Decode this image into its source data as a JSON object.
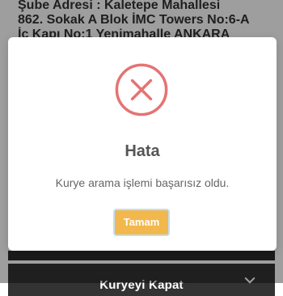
{
  "background": {
    "address_text": "Şube Adresi      : Kaletepe Mahallesi\n862. Sokak A Blok İMC Towers No:6-A\nİç Kapı No:1 Yenimahalle ANKARA",
    "bottom_button_label": "Kuryeyi Kapat"
  },
  "dialog": {
    "title": "Hata",
    "message": "Kurye arama işlemi başarısız oldu.",
    "button_label": "Tamam"
  },
  "colors": {
    "error_icon": "#e57373",
    "primary_button": "#f2b84d",
    "button_focus_ring": "#bfe0f6",
    "bottom_bar": "#333333",
    "overlay": "rgba(0,0,0,0.38)"
  },
  "icons": {
    "dialog_icon": "error-x-circle-icon",
    "bottom_bar_icon": "chevron-down-icon"
  }
}
